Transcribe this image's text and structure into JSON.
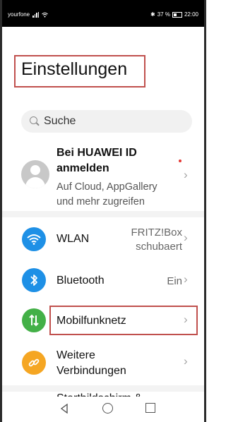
{
  "status_bar": {
    "carrier": "yourfone",
    "battery_text": "37 %",
    "time": "22:00"
  },
  "header": {
    "title": "Einstellungen"
  },
  "search": {
    "placeholder": "Suche"
  },
  "huawei_id": {
    "title": "Bei HUAWEI ID anmelden",
    "subtitle": "Auf Cloud, AppGallery und mehr zugreifen"
  },
  "rows": {
    "wlan": {
      "label": "WLAN",
      "value_line1": "FRITZ!Box",
      "value_line2": "schubaert",
      "icon_color": "#1e90e6"
    },
    "bluetooth": {
      "label": "Bluetooth",
      "value": "Ein",
      "icon_color": "#1e90e6"
    },
    "mobilfunknetz": {
      "label": "Mobilfunknetz",
      "icon_color": "#43b047"
    },
    "weitere": {
      "label": "Weitere Verbindungen",
      "icon_color": "#f5a623"
    },
    "partial": {
      "label": "Startbildschirm &",
      "icon_color": "#43b047"
    }
  },
  "nav_bar": {
    "back_icon": "triangle-back-icon",
    "home_icon": "circle-home-icon",
    "recent_icon": "square-recent-icon"
  },
  "colors": {
    "highlight_box": "#c0504d",
    "notification_dot": "#e53935"
  }
}
